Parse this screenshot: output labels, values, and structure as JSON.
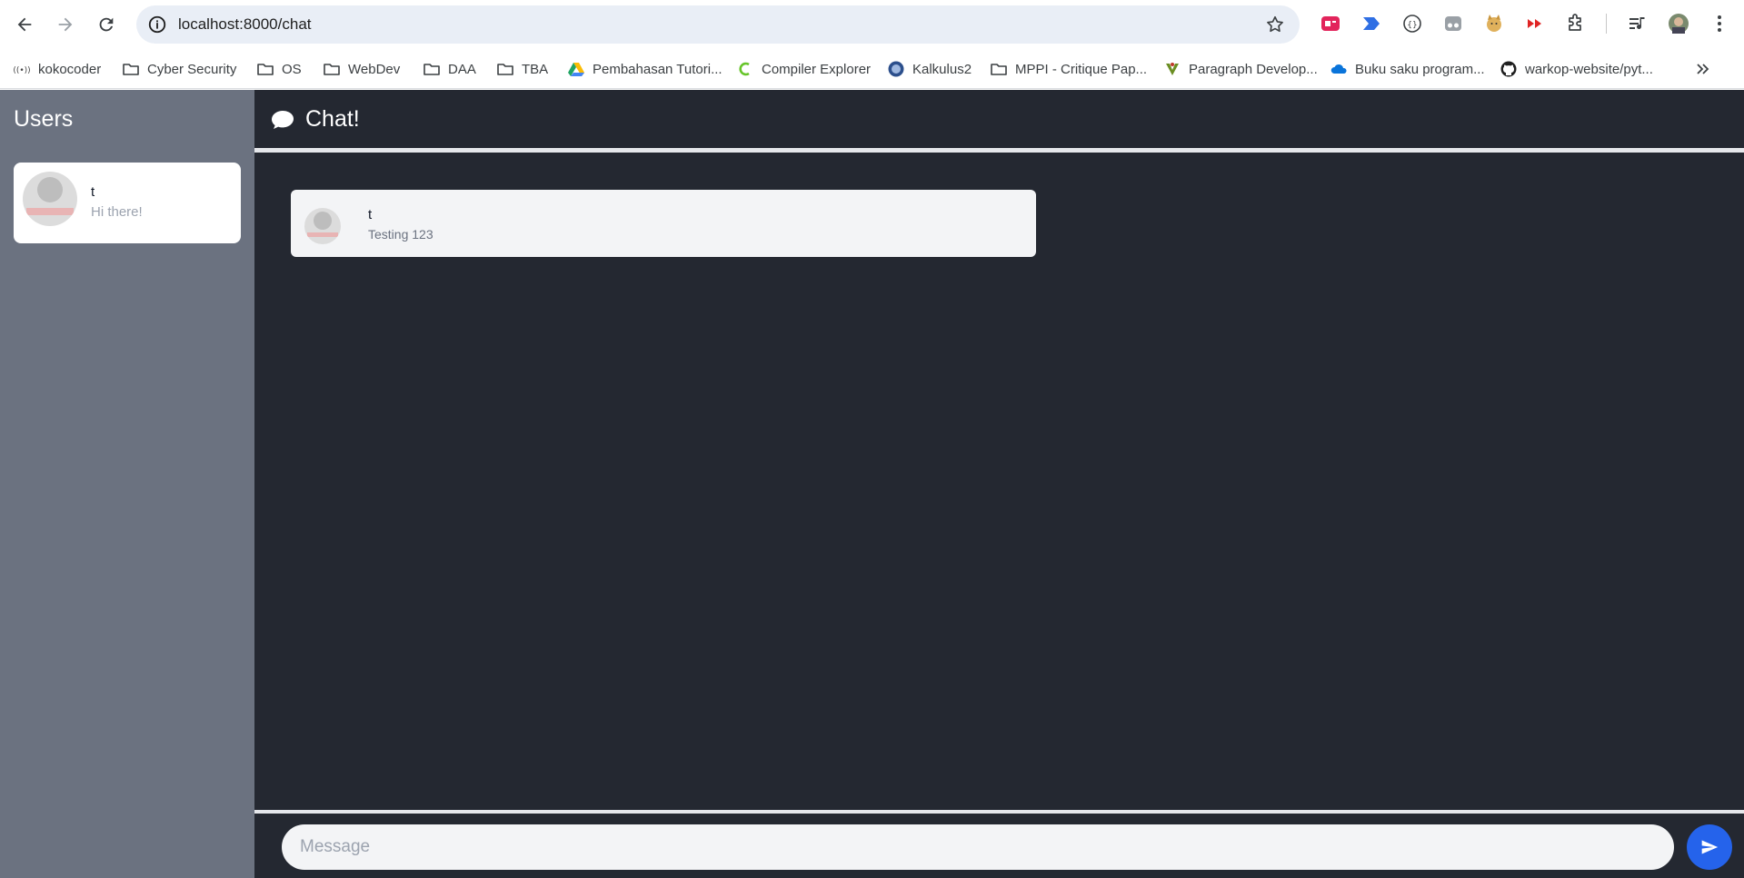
{
  "browser": {
    "url": "localhost:8000/chat",
    "bookmarks": [
      {
        "label": "kokocoder",
        "icon": "radio-icon"
      },
      {
        "label": "Cyber Security",
        "icon": "folder-icon"
      },
      {
        "label": "OS",
        "icon": "folder-icon"
      },
      {
        "label": "WebDev",
        "icon": "folder-icon"
      },
      {
        "label": "DAA",
        "icon": "folder-icon"
      },
      {
        "label": "TBA",
        "icon": "folder-icon"
      },
      {
        "label": "Pembahasan Tutori...",
        "icon": "google-drive-icon"
      },
      {
        "label": "Compiler Explorer",
        "icon": "compiler-explorer-icon"
      },
      {
        "label": "Kalkulus2",
        "icon": "university-seal-icon"
      },
      {
        "label": "MPPI - Critique Pap...",
        "icon": "folder-icon"
      },
      {
        "label": "Paragraph Develop...",
        "icon": "site-favicon-icon"
      },
      {
        "label": "Buku saku program...",
        "icon": "onedrive-icon"
      },
      {
        "label": "warkop-website/pyt...",
        "icon": "github-icon"
      }
    ]
  },
  "sidebar": {
    "title": "Users",
    "users": [
      {
        "name": "t",
        "last_message": "Hi there!"
      }
    ]
  },
  "chat": {
    "title": "Chat!",
    "messages": [
      {
        "sender": "t",
        "text": "Testing 123"
      }
    ],
    "composer": {
      "placeholder": "Message",
      "value": ""
    }
  },
  "colors": {
    "sidebar_bg": "#6b7280",
    "chat_bg": "#242831",
    "send_button": "#2563eb"
  }
}
